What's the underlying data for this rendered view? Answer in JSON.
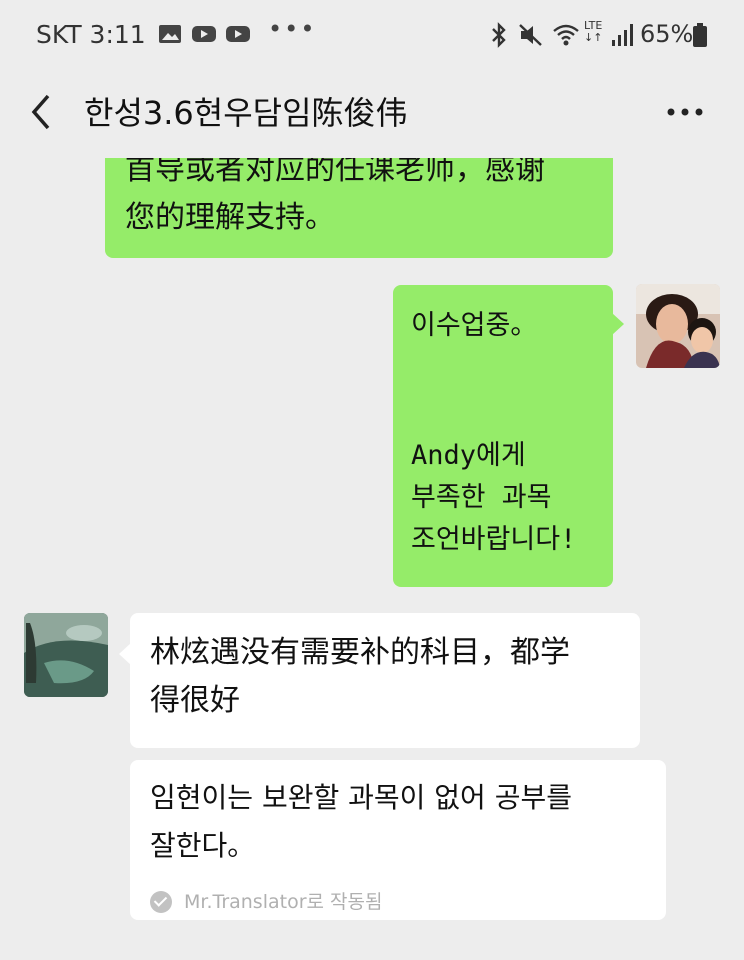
{
  "status_bar": {
    "carrier": "SKT",
    "time": "3:11",
    "network": "LTE",
    "battery": "65%",
    "icons": [
      "gallery-icon",
      "youtube-icon",
      "youtube-icon",
      "more-dots",
      "bluetooth-icon",
      "mute-icon",
      "wifi-icon",
      "lte-icon",
      "signal-icon",
      "battery-icon"
    ]
  },
  "header": {
    "title": "한성3.6현우담임陈俊伟",
    "back_icon": "chevron-left-icon",
    "more_icon": "more-horizontal-icon"
  },
  "messages": [
    {
      "side": "left",
      "color": "#95ec69",
      "lines": [
        "首导或者对应的任课老师，感谢",
        "您的理解支持。"
      ]
    },
    {
      "side": "right",
      "color": "#95ec69",
      "lines": [
        "이수업중。",
        "",
        "",
        "Andy에게",
        "부족한 과목",
        "조언바랍니다!"
      ]
    },
    {
      "side": "left",
      "color": "#ffffff",
      "lines": [
        "林炫遇没有需要补的科目，都学",
        "得很好"
      ]
    },
    {
      "side": "left",
      "color": "#ffffff",
      "lines": [
        "임현이는 보완할 과목이 없어 공부를",
        "잘한다。"
      ],
      "footer": "Mr.Translator로 작동됨"
    }
  ],
  "colors": {
    "background": "#ededed",
    "sent_bubble": "#95ec69",
    "received_bubble": "#ffffff"
  }
}
